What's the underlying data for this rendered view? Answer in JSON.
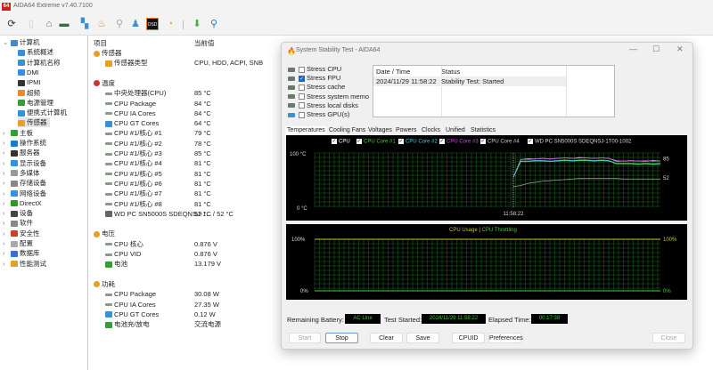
{
  "app": {
    "title": "AIDA64 Extreme v7.40.7100",
    "logo": "64"
  },
  "toolbar": [
    "refresh-icon",
    "report-icon",
    "motherboard-icon",
    "memory-icon",
    "computer-icon",
    "fire-icon",
    "network-icon",
    "user-icon",
    "osd-icon",
    "gauge-icon",
    "download-icon",
    "search-icon"
  ],
  "toolbar_osd": "OSD",
  "tree": [
    {
      "label": "计算机",
      "level": 0,
      "exp": "v",
      "color": "#3a8fd6"
    },
    {
      "label": "系统概述",
      "level": 1,
      "color": "#3a8fd6"
    },
    {
      "label": "计算机名称",
      "level": 1,
      "color": "#3a8fd6"
    },
    {
      "label": "DMI",
      "level": 1,
      "color": "#3a8fd6"
    },
    {
      "label": "IPMI",
      "level": 1,
      "color": "#333"
    },
    {
      "label": "超频",
      "level": 1,
      "color": "#f08a1c"
    },
    {
      "label": "电源管理",
      "level": 1,
      "color": "#3a9a3a"
    },
    {
      "label": "便携式计算机",
      "level": 1,
      "color": "#3a8fd6"
    },
    {
      "label": "传感器",
      "level": 1,
      "color": "#e8a020",
      "selected": true
    },
    {
      "label": "主板",
      "level": 0,
      "exp": ">",
      "color": "#3a9a3a"
    },
    {
      "label": "操作系统",
      "level": 0,
      "exp": ">",
      "color": "#1a78d6"
    },
    {
      "label": "服务器",
      "level": 0,
      "exp": ">",
      "color": "#333"
    },
    {
      "label": "显示设备",
      "level": 0,
      "exp": ">",
      "color": "#3a8fd6"
    },
    {
      "label": "多媒体",
      "level": 0,
      "exp": ">",
      "color": "#999"
    },
    {
      "label": "存储设备",
      "level": 0,
      "exp": ">",
      "color": "#888"
    },
    {
      "label": "网络设备",
      "level": 0,
      "exp": ">",
      "color": "#3a8fd6"
    },
    {
      "label": "DirectX",
      "level": 0,
      "exp": ">",
      "color": "#2a9a2a"
    },
    {
      "label": "设备",
      "level": 0,
      "exp": ">",
      "color": "#444"
    },
    {
      "label": "软件",
      "level": 0,
      "exp": ">",
      "color": "#888"
    },
    {
      "label": "安全性",
      "level": 0,
      "exp": ">",
      "color": "#d83a2a"
    },
    {
      "label": "配置",
      "level": 0,
      "exp": ">",
      "color": "#aaa"
    },
    {
      "label": "数据库",
      "level": 0,
      "exp": ">",
      "color": "#3a6fd6"
    },
    {
      "label": "性能测试",
      "level": 0,
      "exp": ">",
      "color": "#e8a020"
    }
  ],
  "list": {
    "col_item": "项目",
    "col_value": "当前值",
    "rows": [
      {
        "y": 0,
        "item": "传感器",
        "section": true,
        "color": "#e8a020"
      },
      {
        "y": 1,
        "item": "传感器类型",
        "value": "CPU, HDD, ACPI, SNB",
        "color": "#e8a020"
      },
      {
        "y": 3,
        "item": "温度",
        "section": true,
        "color": "#c33"
      },
      {
        "y": 4,
        "item": "中央处理器(CPU)",
        "value": "85 °C"
      },
      {
        "y": 5,
        "item": "CPU Package",
        "value": "84 °C"
      },
      {
        "y": 6,
        "item": "CPU IA Cores",
        "value": "84 °C"
      },
      {
        "y": 7,
        "item": "CPU GT Cores",
        "value": "64 °C",
        "color": "#3a8fd6"
      },
      {
        "y": 8,
        "item": "CPU #1/核心 #1",
        "value": "79 °C"
      },
      {
        "y": 9,
        "item": "CPU #1/核心 #2",
        "value": "78 °C"
      },
      {
        "y": 10,
        "item": "CPU #1/核心 #3",
        "value": "85 °C"
      },
      {
        "y": 11,
        "item": "CPU #1/核心 #4",
        "value": "81 °C"
      },
      {
        "y": 12,
        "item": "CPU #1/核心 #5",
        "value": "81 °C"
      },
      {
        "y": 13,
        "item": "CPU #1/核心 #6",
        "value": "81 °C"
      },
      {
        "y": 14,
        "item": "CPU #1/核心 #7",
        "value": "81 °C"
      },
      {
        "y": 15,
        "item": "CPU #1/核心 #8",
        "value": "81 °C"
      },
      {
        "y": 16,
        "item": "WD PC SN5000S SDEQNSJ-1...",
        "value": "52 °C / 52 °C",
        "color": "#666"
      },
      {
        "y": 18,
        "item": "电压",
        "section": true,
        "color": "#e8a020"
      },
      {
        "y": 19,
        "item": "CPU 核心",
        "value": "0.876 V"
      },
      {
        "y": 20,
        "item": "CPU VID",
        "value": "0.876 V"
      },
      {
        "y": 21,
        "item": "电池",
        "value": "13.179 V",
        "color": "#3a9a3a"
      },
      {
        "y": 23,
        "item": "功耗",
        "section": true,
        "color": "#e8a020"
      },
      {
        "y": 24,
        "item": "CPU Package",
        "value": "30.08 W"
      },
      {
        "y": 25,
        "item": "CPU IA Cores",
        "value": "27.35 W"
      },
      {
        "y": 26,
        "item": "CPU GT Cores",
        "value": "0.12 W",
        "color": "#3a8fd6"
      },
      {
        "y": 27,
        "item": "电池充/放电",
        "value": "交流电源",
        "color": "#3a9a3a"
      }
    ]
  },
  "dialog": {
    "title": "System Stability Test - AIDA64",
    "stress": [
      {
        "label": "Stress CPU",
        "checked": false
      },
      {
        "label": "Stress FPU",
        "checked": true
      },
      {
        "label": "Stress cache",
        "checked": false
      },
      {
        "label": "Stress system memo",
        "checked": false
      },
      {
        "label": "Stress local disks",
        "checked": false
      },
      {
        "label": "Stress GPU(s)",
        "checked": false
      }
    ],
    "log": {
      "col_date": "Date / Time",
      "col_status": "Status",
      "rows": [
        {
          "date": "2024/11/29 11:58:22",
          "status": "Stability Test: Started"
        }
      ]
    },
    "tabs": [
      "Temperatures",
      "Cooling Fans",
      "Voltages",
      "Powers",
      "Clocks",
      "Unified",
      "Statistics"
    ],
    "legend": [
      {
        "label": "CPU",
        "color": "#ffffff"
      },
      {
        "label": "CPU Core #1",
        "color": "#3ccf3c"
      },
      {
        "label": "CPU Core #2",
        "color": "#4fc8d8"
      },
      {
        "label": "CPU Core #3",
        "color": "#c04fd0"
      },
      {
        "label": "CPU Core #4",
        "color": "#cccccc"
      },
      {
        "label": "WD PC SN5000S SDEQNSJ-1T00-1002",
        "color": "#dddddd"
      }
    ],
    "usage_legend": {
      "usage": "CPU Usage",
      "sep": "|",
      "throttle": "CPU Throttling"
    },
    "battery_label": "Remaining Battery:",
    "battery": "AC Line",
    "started_label": "Test Started:",
    "started": "2024/11/29 11:58:22",
    "elapsed_label": "Elapsed Time:",
    "elapsed": "00:17:38",
    "buttons": {
      "start": "Start",
      "stop": "Stop",
      "clear": "Clear",
      "save": "Save",
      "cpuid": "CPUID",
      "prefs": "Preferences",
      "close": "Close"
    }
  },
  "chart_data": [
    {
      "type": "line",
      "title": "Temperatures",
      "ylabel_top": "100 °C",
      "ylabel_bottom": "0 °C",
      "ylim": [
        0,
        100
      ],
      "xlabel": "11:58:22",
      "x": [
        0,
        1,
        2,
        3,
        4,
        5,
        6,
        7,
        8,
        9,
        10,
        11,
        12,
        13,
        14,
        15,
        16,
        17,
        18,
        19,
        20
      ],
      "start_index": 0,
      "series": [
        {
          "name": "CPU",
          "color": "#ffffff",
          "values": [
            55,
            88,
            89,
            89,
            90,
            89,
            90,
            91,
            90,
            91,
            91,
            90,
            91,
            90,
            85,
            85,
            86,
            85,
            85,
            86,
            85
          ]
        },
        {
          "name": "CPU Core #1",
          "color": "#3ccf3c",
          "values": [
            55,
            84,
            84,
            85,
            85,
            84,
            85,
            86,
            85,
            86,
            86,
            85,
            86,
            85,
            80,
            80,
            80,
            79,
            80,
            79,
            79
          ]
        },
        {
          "name": "CPU Core #3",
          "color": "#c04fd0",
          "values": [
            55,
            88,
            88,
            89,
            90,
            89,
            90,
            91,
            90,
            92,
            91,
            90,
            91,
            90,
            86,
            85,
            86,
            85,
            86,
            85,
            85
          ]
        },
        {
          "name": "CPU Core #2",
          "color": "#4fc8d8",
          "values": [
            55,
            85,
            85,
            86,
            86,
            85,
            86,
            87,
            86,
            87,
            87,
            86,
            87,
            86,
            81,
            81,
            81,
            80,
            81,
            80,
            81
          ]
        },
        {
          "name": "WD PC SN5000S SDEQNSJ-1T00-1002",
          "color": "#999999",
          "values": [
            38,
            40,
            44,
            46,
            48,
            49,
            50,
            51,
            52,
            53,
            53,
            53,
            53,
            53,
            53,
            52,
            52,
            52,
            52,
            52,
            52
          ]
        }
      ],
      "end_labels": [
        "85",
        "52"
      ]
    },
    {
      "type": "line",
      "title": "CPU Usage | CPU Throttling",
      "ylabel_top": "100%",
      "ylabel_bottom": "0%",
      "ylim": [
        0,
        100
      ],
      "series": [
        {
          "name": "CPU Usage",
          "color": "#c8c81e",
          "values": [
            100
          ]
        },
        {
          "name": "CPU Throttling",
          "color": "#3ccf3c",
          "values": [
            0
          ]
        }
      ]
    }
  ]
}
